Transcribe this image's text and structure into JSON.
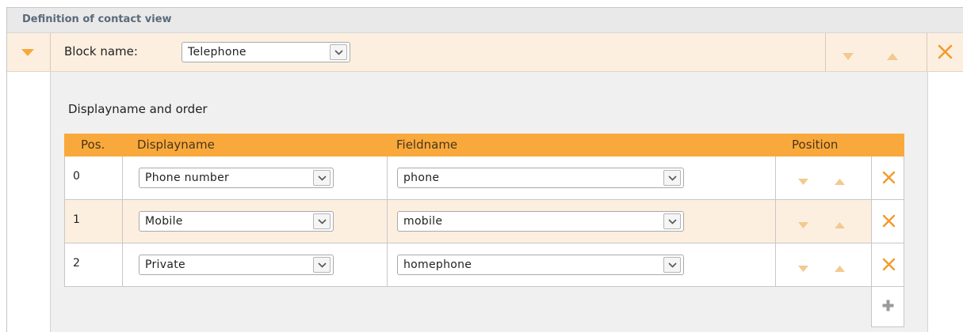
{
  "section": {
    "title": "Definition of contact view"
  },
  "block": {
    "name_label": "Block name:",
    "name_value": "Telephone",
    "actions": [
      "move-down",
      "move-up",
      "delete"
    ]
  },
  "content": {
    "subheading": "Displayname and order",
    "table": {
      "headers": {
        "pos": "Pos.",
        "displayname": "Displayname",
        "fieldname": "Fieldname",
        "position": "Position"
      },
      "rows": [
        {
          "pos": "0",
          "displayname": "Phone number",
          "fieldname": "phone"
        },
        {
          "pos": "1",
          "displayname": "Mobile",
          "fieldname": "mobile"
        },
        {
          "pos": "2",
          "displayname": "Private",
          "fieldname": "homephone"
        }
      ],
      "add_icon": "plus-icon"
    }
  },
  "colors": {
    "accent_orange": "#f9a93c",
    "row_highlight": "#fcefe0",
    "title_bar": "#e9e9e9",
    "panel_bg": "#f0f0f0"
  }
}
